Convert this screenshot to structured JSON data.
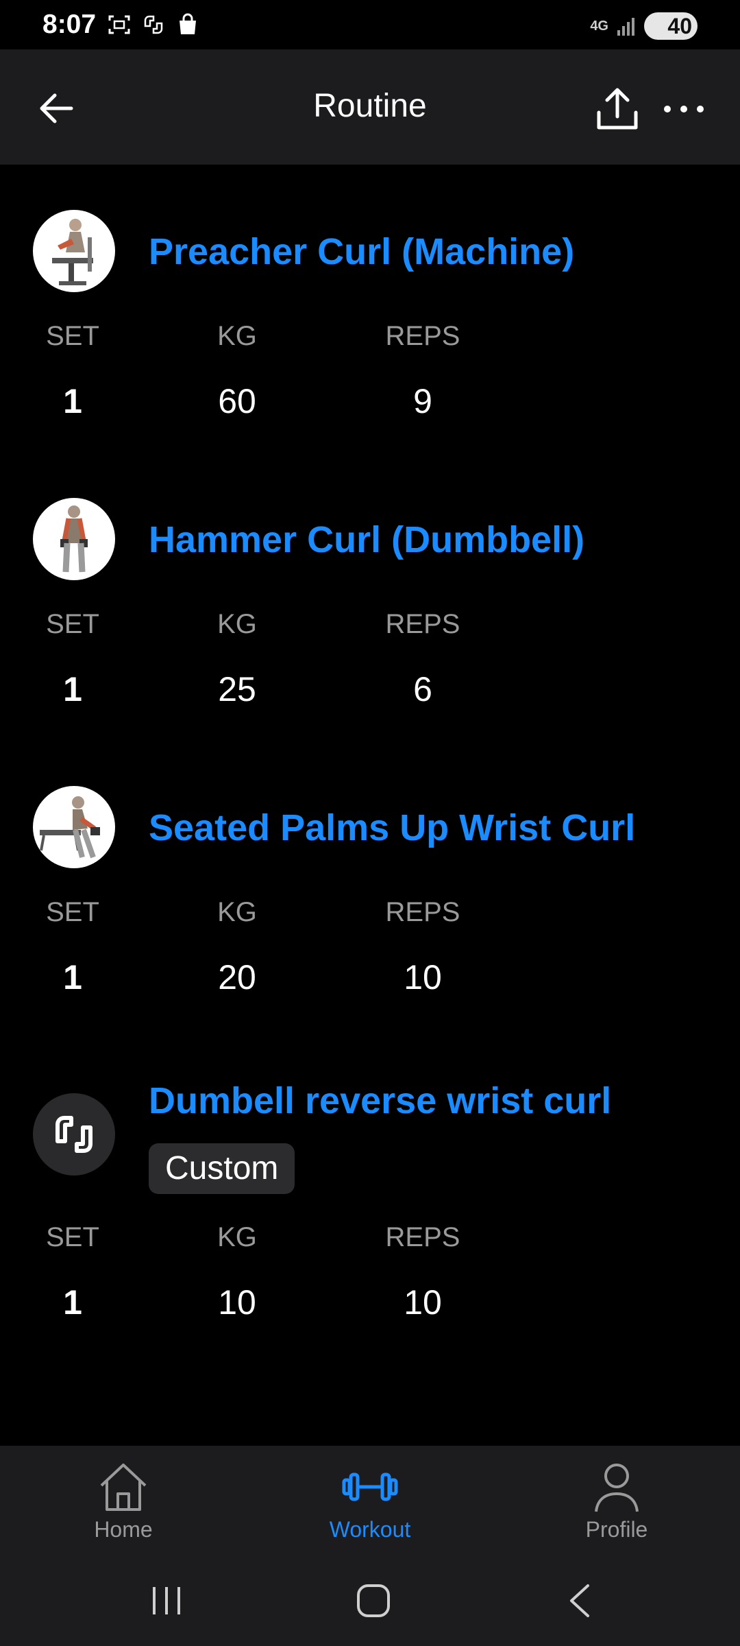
{
  "status": {
    "time": "8:07",
    "network": "4G",
    "battery": "40"
  },
  "appbar": {
    "title": "Routine"
  },
  "columns": {
    "set": "SET",
    "kg": "KG",
    "reps": "REPS"
  },
  "exercises": [
    {
      "name": "Preacher Curl (Machine)",
      "set": "1",
      "kg": "60",
      "reps": "9",
      "thumb_icon": "preacher-curl-illustration"
    },
    {
      "name": "Hammer Curl (Dumbbell)",
      "set": "1",
      "kg": "25",
      "reps": "6",
      "thumb_icon": "hammer-curl-illustration"
    },
    {
      "name": "Seated Palms Up Wrist Curl",
      "set": "1",
      "kg": "20",
      "reps": "10",
      "thumb_icon": "wrist-curl-illustration"
    },
    {
      "name": "Dumbell reverse wrist curl",
      "badge": "Custom",
      "set": "1",
      "kg": "10",
      "reps": "10",
      "thumb_icon": "custom-exercise-icon"
    }
  ],
  "tabs": [
    {
      "label": "Home",
      "icon": "home-icon"
    },
    {
      "label": "Workout",
      "icon": "dumbbell-icon",
      "active": true
    },
    {
      "label": "Profile",
      "icon": "person-icon"
    }
  ],
  "colors": {
    "accent": "#1a8cff",
    "background": "#000000",
    "surface": "#1c1c1e",
    "muted_text": "#9a9a9a"
  }
}
